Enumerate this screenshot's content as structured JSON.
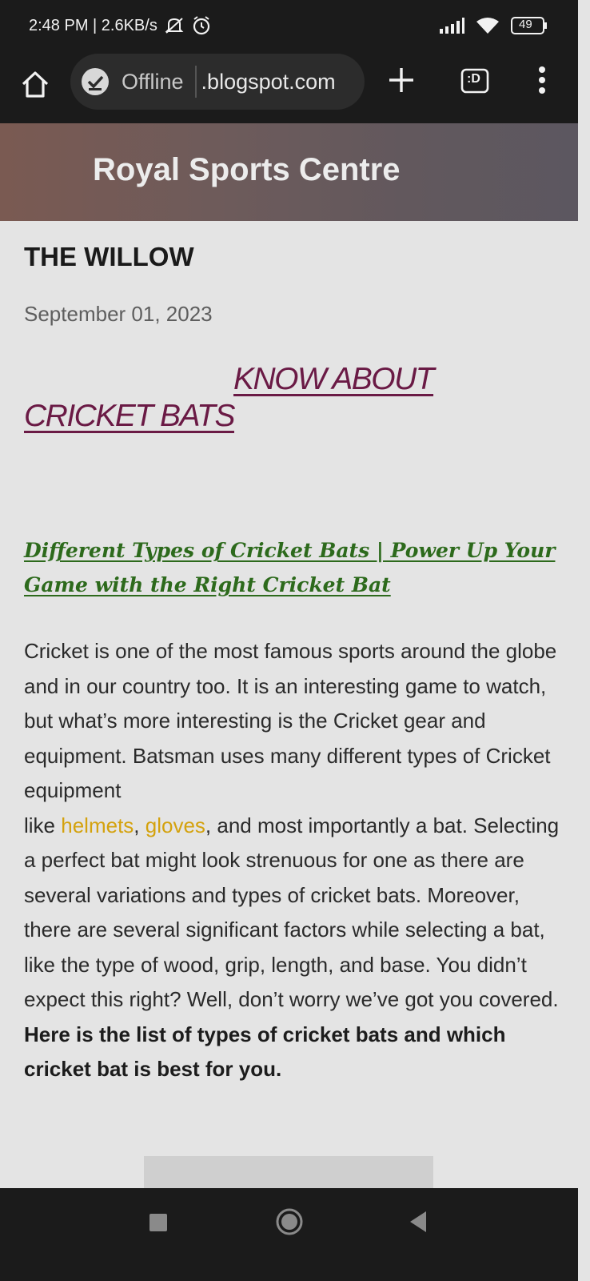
{
  "status_bar": {
    "time_speed": "2:48 PM | 2.6KB/s",
    "battery": "49",
    "icons": [
      "mute-icon",
      "alarm-icon",
      "signal-icon",
      "wifi-icon",
      "battery-icon"
    ]
  },
  "browser": {
    "offline_label": "Offline",
    "url": ".blogspot.com",
    "tabs_label": ":D",
    "icons": [
      "home-icon",
      "offline-check-icon",
      "plus-icon",
      "tabs-icon",
      "menu-dots-icon"
    ]
  },
  "blog": {
    "title": "Royal Sports Centre"
  },
  "post": {
    "title": "THE WILLOW",
    "date": "September 01, 2023",
    "heading_line1": "KNOW ABOUT",
    "heading_line2": "CRICKET BATS",
    "link_line1": "Different Types of Cricket Bats | Power Up Your",
    "link_line2": "Game with the Right Cricket Bat",
    "body": {
      "p1": "Cricket is one of the most famous sports around the globe and in our country too. It is an interesting game to watch, but what’s more interesting is the Cricket gear and equipment. Batsman uses many different types of Cricket equipment",
      "like": "like ",
      "helmets": "helmets",
      "comma": ", ",
      "gloves": "gloves",
      "p2": ", and most importantly a bat. Selecting a perfect bat might look strenuous for one as there are several variations and types of cricket bats. Moreover, there are several significant factors while selecting a bat, like the type of wood, grip, length, and base. You didn’t expect this right? Well, don’t worry we’ve got you covered. ",
      "bold": "Here is the list of types of cricket bats and which cricket bat is best for you."
    }
  },
  "colors": {
    "toolbar_bg": "#1b1b1b",
    "page_bg": "#e4e4e4",
    "heading_link": "#6a1a45",
    "green_link": "#2d6a1c",
    "gold_link": "#d4a20e"
  },
  "nav_bar": {
    "icons": [
      "recents-icon",
      "home-circle-icon",
      "back-icon"
    ]
  }
}
